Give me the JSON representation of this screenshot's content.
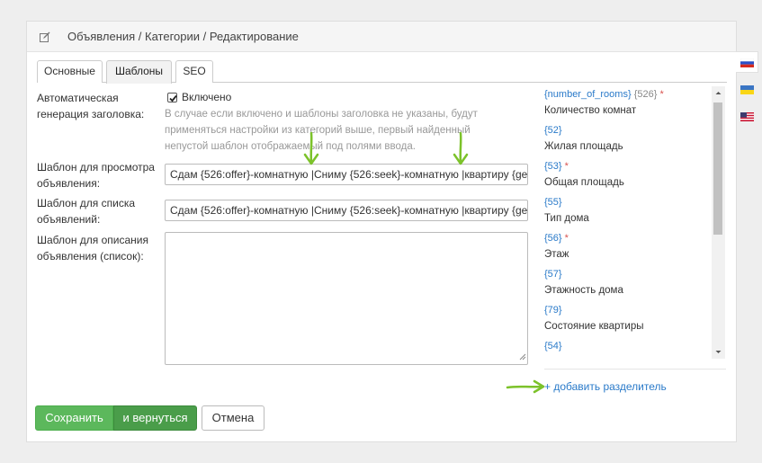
{
  "header": {
    "breadcrumb": "Объявления / Категории / Редактирование",
    "icon": "edit-icon"
  },
  "tabs": [
    {
      "label": "Основные",
      "active": false
    },
    {
      "label": "Шаблоны",
      "active": true
    },
    {
      "label": "SEO",
      "active": false
    }
  ],
  "form": {
    "auto_title_label": "Автоматическая генерация заголовка:",
    "auto_title_checkbox_label": "Включено",
    "auto_title_checked": true,
    "auto_title_hint": "В случае если включено и шаблоны заголовка не указаны, будут применяться настройки из категорий выше, первый найденный непустой шаблон отображаемый под полями ввода.",
    "view_template_label": "Шаблон для просмотра объявления:",
    "view_template_value": "Сдам {526:offer}-комнатную |Сниму {526:seek}-комнатную |квартиру {geo.city}",
    "list_template_label": "Шаблон для списка объявлений:",
    "list_template_value": "Сдам {526:offer}-комнатную |Сниму {526:seek}-комнатную |квартиру {geo.city}",
    "desc_template_label": "Шаблон для описания объявления (список):",
    "desc_template_value": ""
  },
  "fields_list": [
    {
      "code": "{number_of_rooms}",
      "extra": "{526}",
      "required": true,
      "label": "Количество комнат"
    },
    {
      "code": "{52}",
      "extra": "",
      "required": false,
      "label": "Жилая площадь"
    },
    {
      "code": "{53}",
      "extra": "",
      "required": true,
      "label": "Общая площадь"
    },
    {
      "code": "{55}",
      "extra": "",
      "required": false,
      "label": "Тип дома"
    },
    {
      "code": "{56}",
      "extra": "",
      "required": true,
      "label": "Этаж"
    },
    {
      "code": "{57}",
      "extra": "",
      "required": false,
      "label": "Этажность дома"
    },
    {
      "code": "{79}",
      "extra": "",
      "required": false,
      "label": "Состояние квартиры"
    },
    {
      "code": "{54}",
      "extra": "",
      "required": false,
      "label": ""
    }
  ],
  "required_mark": "*",
  "add_separator": "+ добавить разделитель",
  "buttons": {
    "save": "Сохранить",
    "save_return": "и вернуться",
    "cancel": "Отмена"
  },
  "languages": [
    {
      "name": "ru-flag-icon",
      "active": true
    },
    {
      "name": "ua-flag-icon",
      "active": false
    },
    {
      "name": "us-flag-icon",
      "active": false
    }
  ],
  "colors": {
    "accent_green": "#5cb85c",
    "link_blue": "#2a7ac9",
    "required_red": "#d9534f",
    "annotation_arrow": "#7cc22a"
  }
}
